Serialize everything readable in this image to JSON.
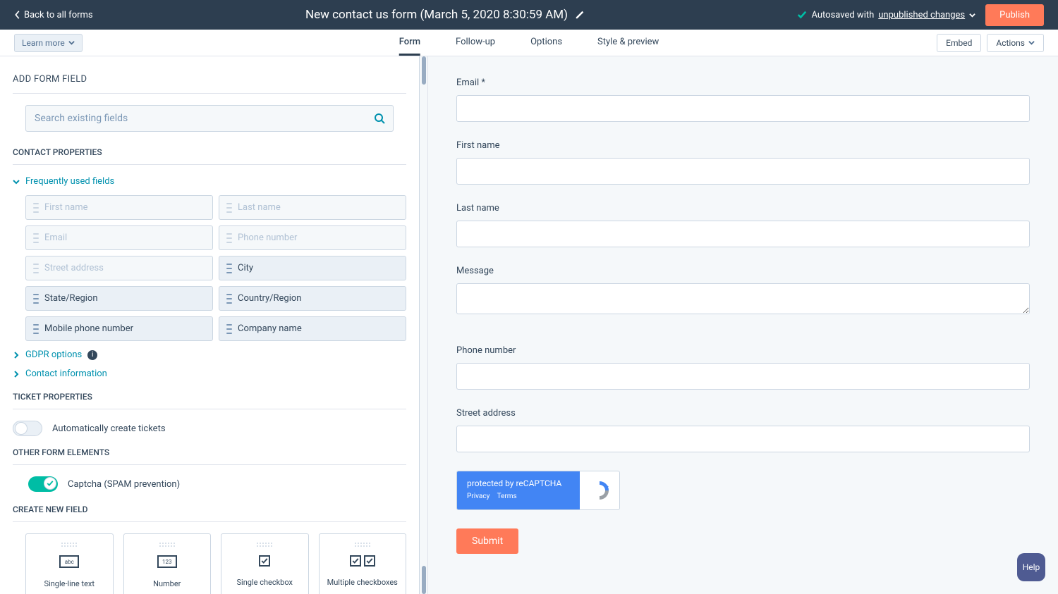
{
  "topbar": {
    "back": "Back to all forms",
    "title": "New contact us form (March 5, 2020 8:30:59 AM)",
    "autosave_prefix": "Autosaved with ",
    "autosave_link": "unpublished changes",
    "publish": "Publish"
  },
  "secondbar": {
    "learn_more": "Learn more",
    "tabs": [
      "Form",
      "Follow-up",
      "Options",
      "Style & preview"
    ],
    "active_tab": 0,
    "embed": "Embed",
    "actions": "Actions"
  },
  "left": {
    "add_form_field": "ADD FORM FIELD",
    "search_placeholder": "Search existing fields",
    "contact_properties": "CONTACT PROPERTIES",
    "freq_used": "Frequently used fields",
    "fields": [
      {
        "label": "First name",
        "disabled": true
      },
      {
        "label": "Last name",
        "disabled": true
      },
      {
        "label": "Email",
        "disabled": true
      },
      {
        "label": "Phone number",
        "disabled": true
      },
      {
        "label": "Street address",
        "disabled": true
      },
      {
        "label": "City",
        "disabled": false
      },
      {
        "label": "State/Region",
        "disabled": false
      },
      {
        "label": "Country/Region",
        "disabled": false
      },
      {
        "label": "Mobile phone number",
        "disabled": false
      },
      {
        "label": "Company name",
        "disabled": false
      }
    ],
    "gdpr": "GDPR options",
    "contact_info": "Contact information",
    "ticket_properties": "TICKET PROPERTIES",
    "auto_create_tickets": "Automatically create tickets",
    "other_elements": "OTHER FORM ELEMENTS",
    "captcha": "Captcha (SPAM prevention)",
    "create_new_field": "CREATE NEW FIELD",
    "new_fields": [
      "Single-line text",
      "Number",
      "Single checkbox",
      "Multiple checkboxes"
    ],
    "new_field_icons": [
      "abc",
      "123"
    ]
  },
  "preview": {
    "fields": [
      {
        "label": "Email *",
        "type": "text"
      },
      {
        "label": "First name",
        "type": "text"
      },
      {
        "label": "Last name",
        "type": "text"
      },
      {
        "label": "Message",
        "type": "textarea"
      },
      {
        "label": "Phone number",
        "type": "text"
      },
      {
        "label": "Street address",
        "type": "text"
      }
    ],
    "recaptcha_text": "protected by reCAPTCHA",
    "recaptcha_privacy": "Privacy",
    "recaptcha_terms": "Terms",
    "submit": "Submit"
  },
  "help": "Help"
}
